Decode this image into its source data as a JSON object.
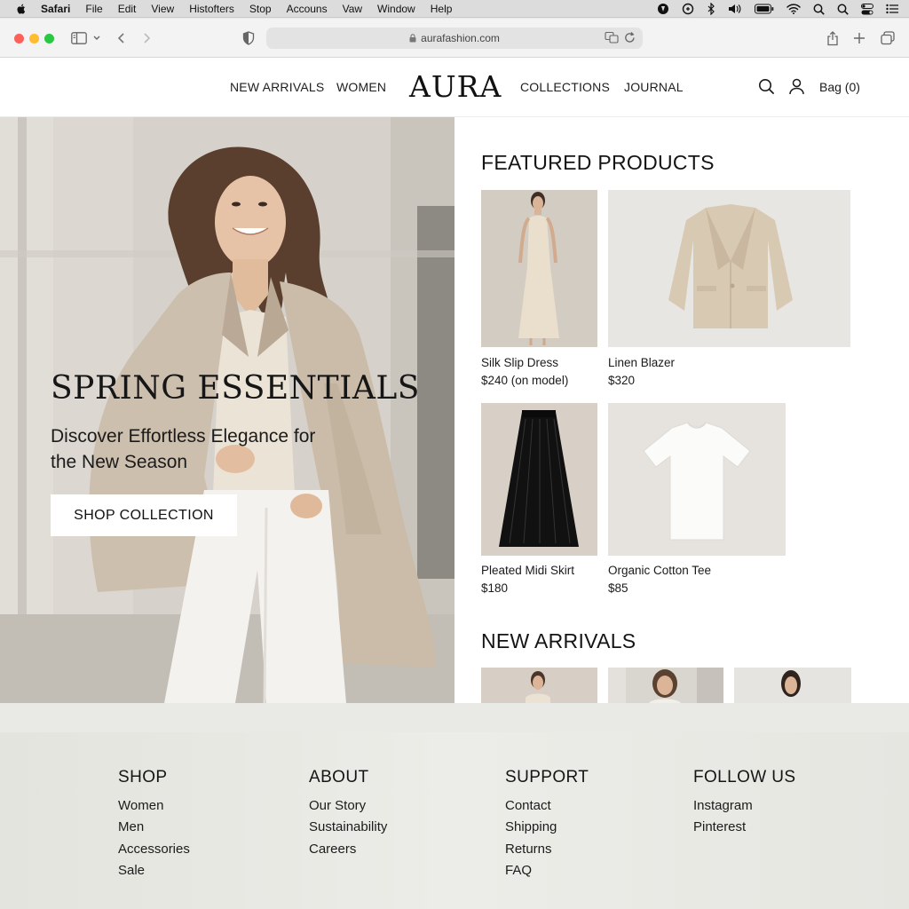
{
  "menubar": {
    "app": "Safari",
    "items": [
      "File",
      "Edit",
      "View",
      "Histofters",
      "Stop",
      "Accouns",
      "Vaw",
      "Window",
      "Help"
    ]
  },
  "browser": {
    "url": "aurafashion.com"
  },
  "header": {
    "logo": "AURA",
    "nav_left": [
      "NEW ARRIVALS",
      "WOMEN"
    ],
    "nav_right": [
      "COLLECTIONS",
      "JOURNAL"
    ],
    "bag_label": "Bag (0)"
  },
  "hero": {
    "title": "SPRING ESSENTIALS",
    "subtitle": "Discover Effortless Elegance for the New Season",
    "button_label": "SHOP COLLECTION"
  },
  "featured": {
    "title": "FEATURED PRODUCTS",
    "products": [
      {
        "name": "Silk Slip Dress",
        "price": "$240 (on model)"
      },
      {
        "name": "Linen Blazer",
        "price": "$320"
      },
      {
        "name": "Pleated Midi Skirt",
        "price": "$180"
      },
      {
        "name": "Organic Cotton Tee",
        "price": "$85"
      }
    ]
  },
  "new_arrivals": {
    "title": "NEW ARRIVALS"
  },
  "footer": {
    "columns": [
      {
        "heading": "SHOP",
        "links": [
          "Women",
          "Men",
          "Accessories",
          "Sale"
        ]
      },
      {
        "heading": "ABOUT",
        "links": [
          "Our Story",
          "Sustainability",
          "Careers"
        ]
      },
      {
        "heading": "SUPPORT",
        "links": [
          "Contact",
          "Shipping",
          "Returns",
          "FAQ"
        ]
      },
      {
        "heading": "FOLLOW US",
        "links": [
          "Instagram",
          "Pinterest"
        ]
      }
    ]
  },
  "colors": {
    "page_bg": "#ffffff",
    "footer_bg": "#e8e8e3",
    "text": "#1a1a1a",
    "button_bg": "#ffffff"
  }
}
